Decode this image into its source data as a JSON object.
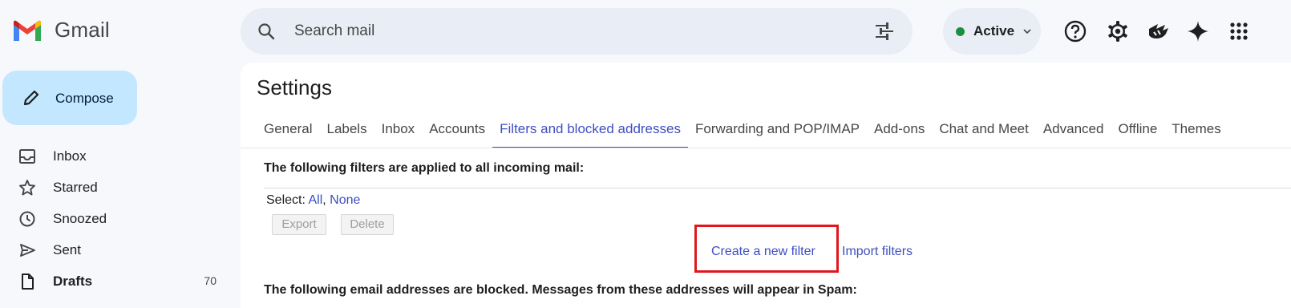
{
  "app": {
    "name": "Gmail"
  },
  "search": {
    "placeholder": "Search mail",
    "icon": "search-icon",
    "options_icon": "tune-icon"
  },
  "status": {
    "label": "Active",
    "color": "#1e8e3e"
  },
  "top_icons": [
    "help-icon",
    "gear-icon",
    "apps-script-icon",
    "gemini-icon",
    "apps-grid-icon"
  ],
  "compose": {
    "label": "Compose"
  },
  "nav": [
    {
      "label": "Inbox",
      "icon": "inbox-icon",
      "count": ""
    },
    {
      "label": "Starred",
      "icon": "star-icon",
      "count": ""
    },
    {
      "label": "Snoozed",
      "icon": "clock-icon",
      "count": ""
    },
    {
      "label": "Sent",
      "icon": "send-icon",
      "count": ""
    },
    {
      "label": "Drafts",
      "icon": "draft-icon",
      "count": "70"
    }
  ],
  "settings": {
    "title": "Settings",
    "tabs": [
      "General",
      "Labels",
      "Inbox",
      "Accounts",
      "Filters and blocked addresses",
      "Forwarding and POP/IMAP",
      "Add-ons",
      "Chat and Meet",
      "Advanced",
      "Offline",
      "Themes"
    ],
    "active_tab": "Filters and blocked addresses",
    "filters_heading": "The following filters are applied to all incoming mail:",
    "select_label": "Select:",
    "select_all": "All",
    "select_sep": ",",
    "select_none": "None",
    "export_label": "Export",
    "delete_label": "Delete",
    "create_filter_label": "Create a new filter",
    "import_filters_label": "Import filters",
    "blocked_heading": "The following email addresses are blocked. Messages from these addresses will appear in Spam:"
  },
  "colors": {
    "accent": "#3d4fc1",
    "compose_bg": "#c2e7ff",
    "highlight": "#e0181e"
  }
}
